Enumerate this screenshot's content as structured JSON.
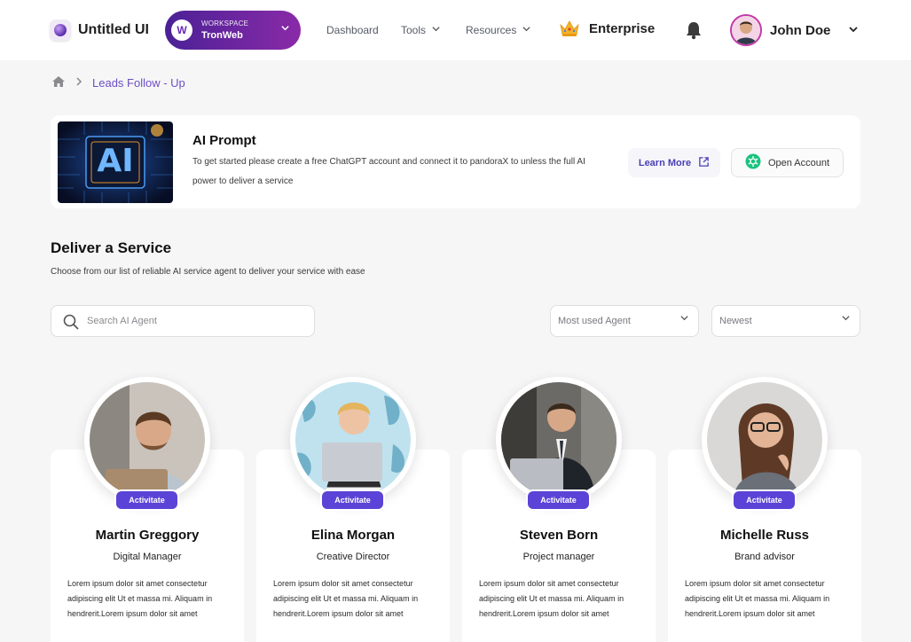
{
  "brand": {
    "name": "Untitled UI"
  },
  "workspace": {
    "label": "WORKSPACE",
    "name": "TronWeb",
    "logo_letter": "W"
  },
  "nav": {
    "dashboard": "Dashboard",
    "tools": "Tools",
    "resources": "Resources",
    "enterprise": "Enterprise"
  },
  "user": {
    "name": "John Doe"
  },
  "breadcrumb": {
    "current": "Leads Follow - Up"
  },
  "prompt": {
    "image_text": "AI",
    "title": "AI Prompt",
    "description": "To get started please create a free ChatGPT account and connect it to pandoraX to unless the full AI power to deliver a service",
    "learn_more": "Learn More",
    "open_account": "Open Account"
  },
  "section": {
    "title": "Deliver a Service",
    "subtitle": "Choose from our list of reliable AI service agent to deliver your service with ease"
  },
  "search": {
    "placeholder": "Search AI Agent",
    "value": ""
  },
  "filters": {
    "sort_agent": "Most used Agent",
    "sort_order": "Newest"
  },
  "agents": [
    {
      "name": "Martin Greggory",
      "role": "Digital Manager",
      "action": "Activitate",
      "description": "Lorem ipsum dolor sit amet consectetur adipiscing elit Ut et massa mi. Aliquam in hendrerit.Lorem ipsum dolor sit amet"
    },
    {
      "name": "Elina Morgan",
      "role": "Creative Director",
      "action": "Activitate",
      "description": "Lorem ipsum dolor sit amet consectetur adipiscing elit Ut et massa mi. Aliquam in hendrerit.Lorem ipsum dolor sit amet"
    },
    {
      "name": "Steven Born",
      "role": "Project manager",
      "action": "Activitate",
      "description": "Lorem ipsum dolor sit amet consectetur adipiscing elit Ut et massa mi. Aliquam in hendrerit.Lorem ipsum dolor sit amet"
    },
    {
      "name": "Michelle Russ",
      "role": "Brand advisor",
      "action": "Activitate",
      "description": "Lorem ipsum dolor sit amet consectetur adipiscing elit Ut et massa mi. Aliquam in hendrerit.Lorem ipsum dolor sit amet"
    }
  ],
  "colors": {
    "accent": "#5a43d6",
    "workspace_start": "#4b2196",
    "workspace_end": "#8a2aa8",
    "breadcrumb": "#6d4fc4"
  },
  "icons": [
    "brand-logo-icon",
    "chevron-down-icon",
    "crown-icon",
    "bell-icon",
    "home-icon",
    "chevron-right-icon",
    "external-link-icon",
    "chatgpt-icon",
    "search-icon"
  ]
}
